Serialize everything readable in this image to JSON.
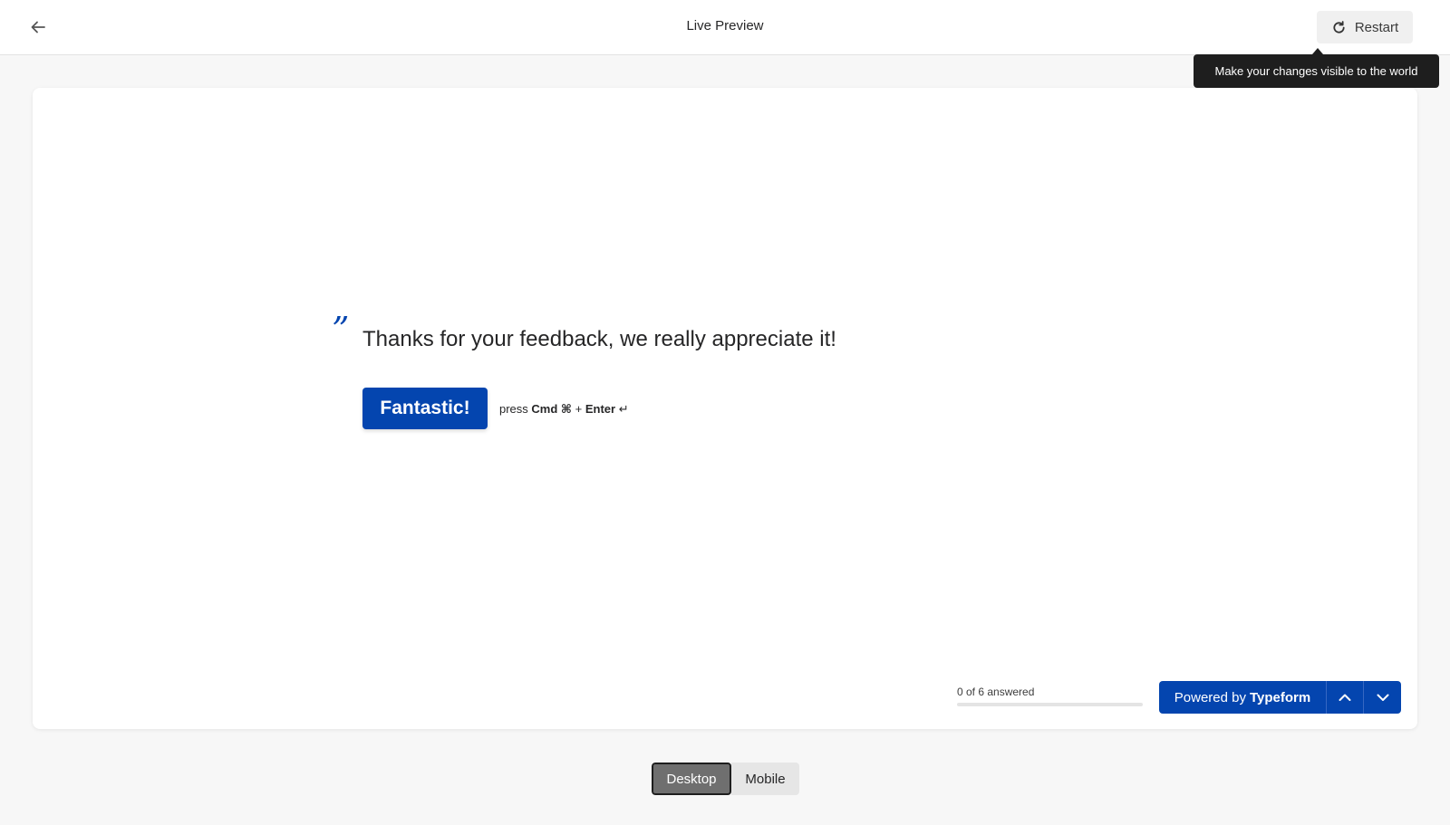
{
  "header": {
    "title": "Live Preview",
    "restart_label": "Restart",
    "tooltip": "Make your changes visible to the world"
  },
  "form": {
    "quote_mark": "”",
    "message": "Thanks for your feedback, we really appreciate it!",
    "submit_label": "Fantastic!",
    "hint": {
      "prefix": "press",
      "key1": "Cmd ⌘",
      "plus": "+",
      "key2": "Enter",
      "enter_symbol": "↵"
    }
  },
  "footer": {
    "progress_label": "0 of 6 answered",
    "progress_fraction": 0,
    "powered_prefix": "Powered by",
    "powered_brand": "Typeform"
  },
  "device_toggle": {
    "desktop": "Desktop",
    "mobile": "Mobile",
    "selected": "Desktop"
  },
  "colors": {
    "accent": "#0445af",
    "tooltip_bg": "#1e1e1e"
  },
  "icons": {
    "back": "arrow-left-icon",
    "restart": "refresh-icon",
    "up": "chevron-up-icon",
    "down": "chevron-down-icon"
  }
}
